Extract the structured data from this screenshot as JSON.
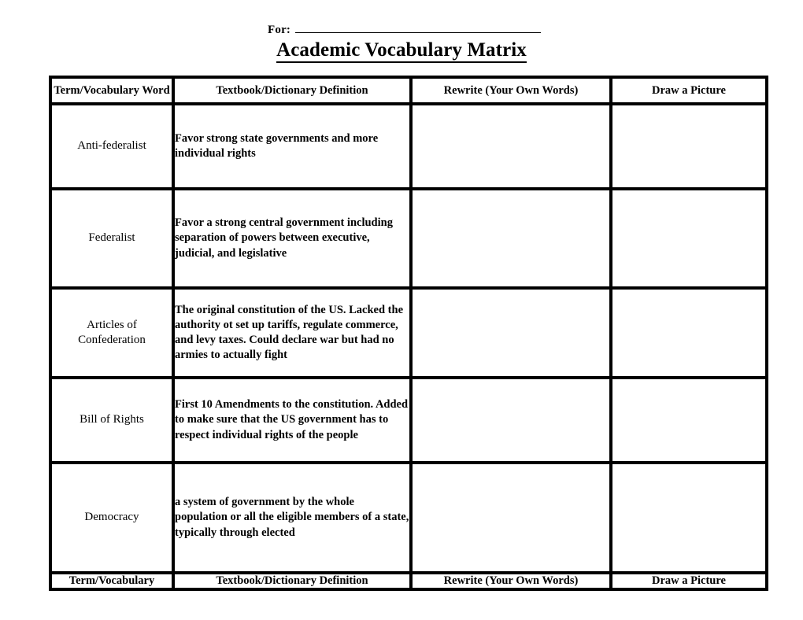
{
  "header": {
    "for_label": "For:",
    "for_value": "",
    "title": "Academic Vocabulary Matrix"
  },
  "table": {
    "columns": [
      {
        "header": "Term/Vocabulary Word",
        "footer": "Term/Vocabulary"
      },
      {
        "header": "Textbook/Dictionary Definition",
        "footer": "Textbook/Dictionary Definition"
      },
      {
        "header": "Rewrite (Your Own Words)",
        "footer": "Rewrite (Your Own Words)"
      },
      {
        "header": "Draw a Picture",
        "footer": "Draw a Picture"
      }
    ],
    "rows": [
      {
        "term": "Anti-federalist",
        "definition": "Favor strong state governments and more individual rights",
        "rewrite": "",
        "picture": ""
      },
      {
        "term": "Federalist",
        "definition": "Favor a strong central government including separation of powers between executive, judicial, and legislative",
        "rewrite": "",
        "picture": ""
      },
      {
        "term": "Articles of Confederation",
        "definition": "The original constitution of the US. Lacked the authority ot set up tariffs, regulate commerce, and levy taxes. Could declare war but had no armies to actually fight",
        "rewrite": "",
        "picture": ""
      },
      {
        "term": "Bill of Rights",
        "definition": "First 10 Amendments to the constitution. Added to make sure that the US government has to respect individual rights of the people",
        "rewrite": "",
        "picture": ""
      },
      {
        "term": "Democracy",
        "definition": "a system of government by the whole population or all the eligible members of a state, typically through elected",
        "rewrite": "",
        "picture": ""
      }
    ]
  },
  "colors": {
    "ink": "#000000",
    "paper": "#ffffff"
  }
}
